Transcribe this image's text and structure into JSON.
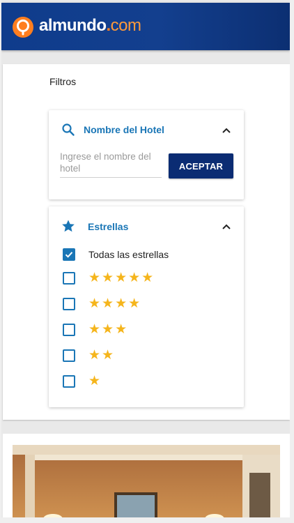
{
  "brand": {
    "name_part1": "almundo",
    "name_dot": ".",
    "name_part2": "com",
    "accent_color": "#ff7e1f",
    "header_color": "#0f3c8c"
  },
  "filters": {
    "title": "Filtros",
    "hotel_name": {
      "title": "Nombre del Hotel",
      "icon": "search-icon",
      "input_placeholder": "Ingrese el nombre del hotel",
      "input_value": "",
      "accept_label": "ACEPTAR",
      "expanded": true
    },
    "stars": {
      "title": "Estrellas",
      "icon": "star-icon",
      "expanded": true,
      "options": [
        {
          "label": "Todas las estrellas",
          "checked": true,
          "stars": ""
        },
        {
          "label": "",
          "checked": false,
          "stars": "★★★★★"
        },
        {
          "label": "",
          "checked": false,
          "stars": "★★★★"
        },
        {
          "label": "",
          "checked": false,
          "stars": "★★★"
        },
        {
          "label": "",
          "checked": false,
          "stars": "★★"
        },
        {
          "label": "",
          "checked": false,
          "stars": "★"
        }
      ],
      "star_color": "#f5b51c",
      "checkbox_color": "#1a76b6"
    }
  }
}
